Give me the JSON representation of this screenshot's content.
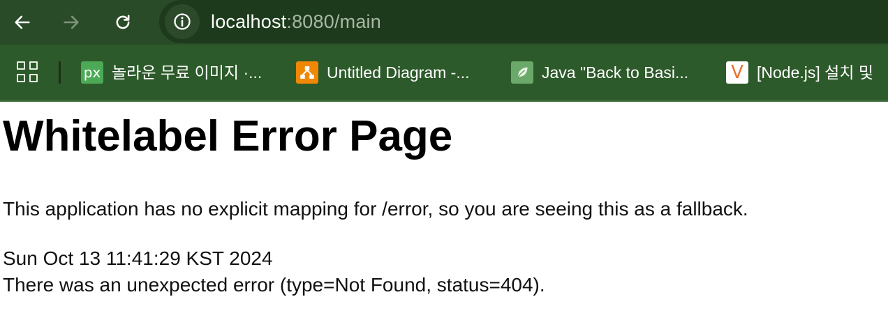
{
  "browser": {
    "url_host": "localhost",
    "url_rest": ":8080/main",
    "bookmarks": [
      {
        "label": "놀라운 무료 이미지 ·...",
        "icon": "pixabay-icon",
        "icon_text": "px"
      },
      {
        "label": "Untitled Diagram -...",
        "icon": "drawio-icon"
      },
      {
        "label": "Java \"Back to Basi...",
        "icon": "leaf-icon"
      },
      {
        "label": "[Node.js] 설치 및",
        "icon": "velog-icon",
        "icon_text": "V"
      }
    ]
  },
  "page": {
    "title": "Whitelabel Error Page",
    "message": "This application has no explicit mapping for /error, so you are seeing this as a fallback.",
    "timestamp": "Sun Oct 13 11:41:29 KST 2024",
    "error": "There was an unexpected error (type=Not Found, status=404)."
  },
  "colors": {
    "toolbar": "#2a4b27",
    "bookmarks_bar": "#2d5a2a",
    "pixabay": "#4caa56",
    "drawio": "#f08705",
    "leaf": "#6aa96a"
  }
}
